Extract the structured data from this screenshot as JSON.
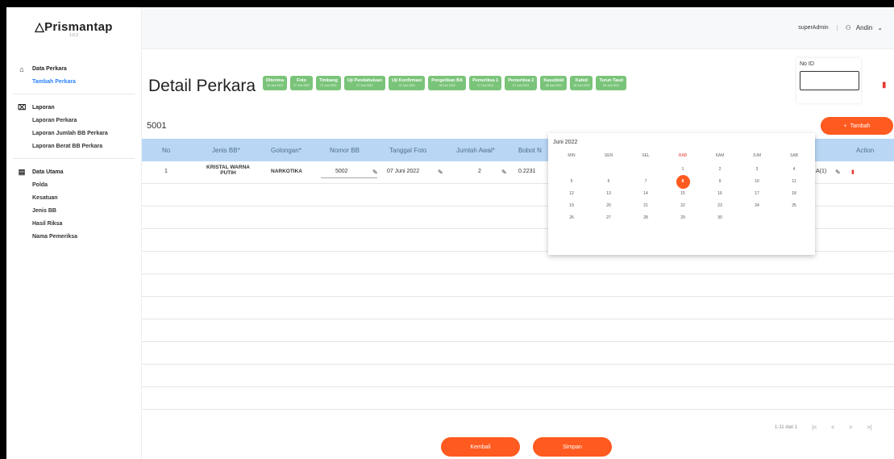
{
  "brand": {
    "name": "Prismantap",
    "version": "1.0.2"
  },
  "sidebar": {
    "groups": [
      {
        "label": "Data Perkara",
        "icon": "home-icon",
        "items": [
          "Tambah Perkara"
        ]
      },
      {
        "label": "Laporan",
        "icon": "report-icon",
        "items": [
          "Laporan Perkara",
          "Laporan Jumlah BB Perkara",
          "Laporan Berat BB Perkara"
        ]
      },
      {
        "label": "Data Utama",
        "icon": "database-icon",
        "items": [
          "Polda",
          "Kesatuan",
          "Jenis BB",
          "Hasil Riksa",
          "Nama Pemeriksa"
        ]
      }
    ]
  },
  "topbar": {
    "role": "superAdmin",
    "user": "Andin"
  },
  "page": {
    "title": "Detail Perkara",
    "case_id": "5001",
    "no_id_label": "No ID",
    "add_label": "Tambah"
  },
  "steps": [
    {
      "label": "Diterima",
      "date": "06 Juni 2022"
    },
    {
      "label": "Foto",
      "date": "07 Juni 2022"
    },
    {
      "label": "Timbang",
      "date": "07 Juni 2022"
    },
    {
      "label": "Uji Pendahuluan",
      "date": "07 Juni 2022"
    },
    {
      "label": "Uji Konfirmasi",
      "date": "07 Juni 2022"
    },
    {
      "label": "Pengetikan BA",
      "date": "08 Juni 2022"
    },
    {
      "label": "Pemeriksa 1",
      "date": "07 Juni 2022"
    },
    {
      "label": "Pemeriksa 2",
      "date": "07 Juni 2022"
    },
    {
      "label": "Kasubbid",
      "date": "08 Juni 2022"
    },
    {
      "label": "Kabid",
      "date": "08 Juni 2022"
    },
    {
      "label": "Turun Taud",
      "date": "08 Juni 2022"
    }
  ],
  "table": {
    "headers": [
      "No",
      "Jenis BB*",
      "Golongan*",
      "Nomor BB",
      "Tanggal Foto",
      "Jumlah Awal*",
      "Bobot N",
      "Action"
    ],
    "row": {
      "no": "1",
      "jenis": "KRISTAL WARNA PUTIH",
      "golongan": "NARKOTIKA",
      "nomor": "5002",
      "tanggal": "07 Juni 2022",
      "jumlah": "2",
      "bobot": "0.2231",
      "extra": "A(1)"
    }
  },
  "calendar": {
    "month": "Juni 2022",
    "weekdays": [
      "MIN",
      "SEN",
      "SEL",
      "RAB",
      "KAM",
      "JUM",
      "SAB"
    ],
    "highlight_weekday": "RAB",
    "selected": "8",
    "weeks": [
      [
        "",
        "",
        "",
        "1",
        "2",
        "3",
        "4"
      ],
      [
        "5",
        "6",
        "7",
        "8",
        "9",
        "10",
        "11"
      ],
      [
        "12",
        "13",
        "14",
        "15",
        "16",
        "17",
        "18"
      ],
      [
        "19",
        "20",
        "21",
        "22",
        "23",
        "24",
        "25"
      ],
      [
        "26",
        "27",
        "28",
        "29",
        "30",
        "",
        ""
      ]
    ]
  },
  "pager": {
    "range": "1-11 dari 1"
  },
  "buttons": {
    "back": "Kembali",
    "save": "Simpan"
  },
  "colors": {
    "accent": "#ff5a1f",
    "step": "#7ac47a",
    "header": "#b9d7f5",
    "link": "#2b83ff"
  }
}
